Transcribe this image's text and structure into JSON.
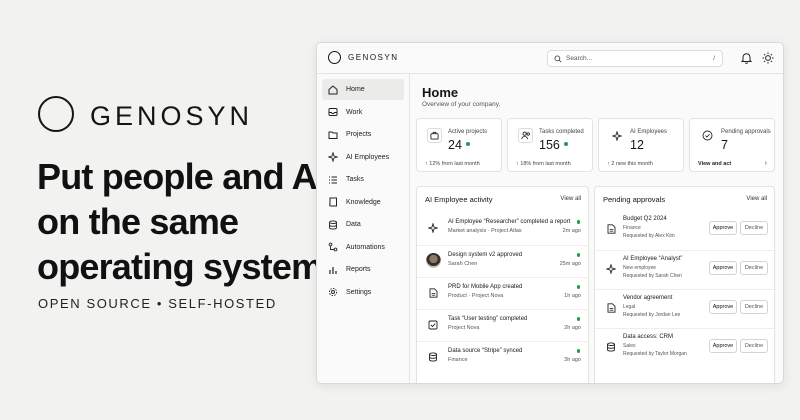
{
  "hero": {
    "brand": "GENOSYN",
    "headline": "Put people and AI on the same operating system.",
    "tagline": "OPEN SOURCE • SELF-HOSTED"
  },
  "app": {
    "brand": "GENOSYN",
    "search": {
      "placeholder": "Search...",
      "shortcut": "/"
    },
    "sidebar": {
      "items": [
        {
          "label": "Home",
          "icon": "home-icon",
          "active": true
        },
        {
          "label": "Work",
          "icon": "inbox-icon"
        },
        {
          "label": "Projects",
          "icon": "folder-icon"
        },
        {
          "label": "AI Employees",
          "icon": "sparkle-icon"
        },
        {
          "label": "Tasks",
          "icon": "list-icon"
        },
        {
          "label": "Knowledge",
          "icon": "book-icon"
        },
        {
          "label": "Data",
          "icon": "database-icon"
        },
        {
          "label": "Automations",
          "icon": "automation-icon"
        },
        {
          "label": "Reports",
          "icon": "bar-chart-icon"
        },
        {
          "label": "Settings",
          "icon": "gear-icon"
        }
      ]
    },
    "main": {
      "title": "Home",
      "subtitle": "Overview of your company.",
      "stats": [
        {
          "label": "Active projects",
          "value": "24",
          "foot": "↑ 12% from last month",
          "dot": true,
          "icon": "briefcase-icon"
        },
        {
          "label": "Tasks completed",
          "value": "156",
          "foot": "↑ 18% from last month",
          "dot": true,
          "icon": "users-icon"
        },
        {
          "label": "AI Employees",
          "value": "12",
          "foot": "↑ 2 new this month",
          "dot": false,
          "icon": "sparkle-icon"
        },
        {
          "label": "Pending approvals",
          "value": "7",
          "foot": "View and act",
          "dot": false,
          "icon": "check-circle-icon"
        }
      ],
      "activity": {
        "title": "AI Employee activity",
        "view_all": "View all",
        "items": [
          {
            "title": "AI Employee “Researcher” completed a report",
            "sub": "Market analysis · Project Atlas",
            "time": "2m ago",
            "icon": "sparkle-icon",
            "dot": true
          },
          {
            "title": "Design system v2 approved",
            "sub": "Sarah Chen",
            "time": "25m ago",
            "icon": "avatar",
            "dot": true
          },
          {
            "title": "PRD for Mobile App created",
            "sub": "Product · Project Nova",
            "time": "1h ago",
            "icon": "document-icon",
            "dot": true
          },
          {
            "title": "Task “User testing” completed",
            "sub": "Project Nova",
            "time": "2h ago",
            "icon": "checkbox-icon",
            "dot": true
          },
          {
            "title": "Data source “Stripe” synced",
            "sub": "Finance",
            "time": "3h ago",
            "icon": "database-icon",
            "dot": true
          }
        ]
      },
      "approvals": {
        "title": "Pending approvals",
        "view_all": "View all",
        "approve_label": "Approve",
        "decline_label": "Decline",
        "items": [
          {
            "title": "Budget Q2 2024",
            "sub": "Finance",
            "requested": "Requested by Alex Kim",
            "icon": "document-icon"
          },
          {
            "title": "AI Employee “Analyst”",
            "sub": "New employee",
            "requested": "Requested by Sarah Chen",
            "icon": "sparkle-icon"
          },
          {
            "title": "Vendor agreement",
            "sub": "Legal",
            "requested": "Requested by Jordan Lee",
            "icon": "document-icon"
          },
          {
            "title": "Data access: CRM",
            "sub": "Sales",
            "requested": "Requested by Taylor Morgan",
            "icon": "database-icon"
          }
        ]
      }
    }
  },
  "colors": {
    "background": "#f2f2f1",
    "accent_green": "#1f9d4c",
    "text": "#151515"
  }
}
